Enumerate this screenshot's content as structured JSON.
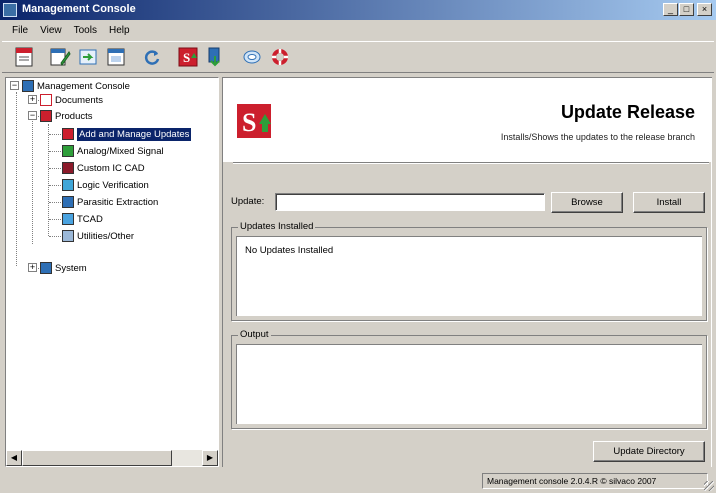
{
  "window": {
    "title": "Management Console",
    "buttons": {
      "minimize": "_",
      "maximize": "□",
      "close": "×"
    }
  },
  "menu": [
    "File",
    "View",
    "Tools",
    "Help"
  ],
  "toolbar": {
    "icons": [
      "report-icon",
      "edit-icon",
      "import-icon",
      "window-icon",
      "refresh-icon",
      "s-update-icon",
      "download-icon",
      "network-icon",
      "lifebuoy-icon"
    ]
  },
  "tree": {
    "root": "Management Console",
    "documents": "Documents",
    "products": "Products",
    "items": [
      "Add and Manage Updates",
      "Analog/Mixed Signal",
      "Custom IC CAD",
      "Logic Verification",
      "Parasitic Extraction",
      "TCAD",
      "Utilities/Other"
    ],
    "system": "System"
  },
  "panel": {
    "heading": "Update Release",
    "subheading": "Installs/Shows the updates to the release branch",
    "update_label": "Update:",
    "update_value": "",
    "browse_label": "Browse",
    "install_label": "Install",
    "installed_group": "Updates Installed",
    "installed_text": "No Updates Installed",
    "output_group": "Output",
    "output_text": "",
    "update_directory_label": "Update Directory"
  },
  "status": {
    "text": "Management console 2.0.4.R © silvaco 2007"
  },
  "colors": {
    "accent": "#0a246a",
    "brand_red": "#cc1f2d",
    "brand_green": "#2e9e3a"
  }
}
